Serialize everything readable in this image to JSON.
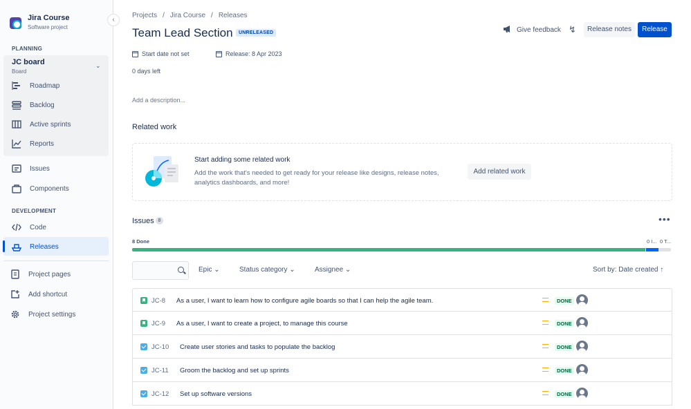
{
  "project": {
    "name": "Jira Course",
    "type": "Software project"
  },
  "sidebar": {
    "planning_label": "PLANNING",
    "board": {
      "name": "JC board",
      "sub": "Board"
    },
    "board_items": [
      "Roadmap",
      "Backlog",
      "Active sprints",
      "Reports"
    ],
    "items": [
      "Issues",
      "Components"
    ],
    "development_label": "DEVELOPMENT",
    "dev_items": [
      "Code",
      "Releases"
    ],
    "bottom_items": [
      "Project pages",
      "Add shortcut",
      "Project settings"
    ]
  },
  "breadcrumbs": [
    "Projects",
    "/",
    "Jira Course",
    "/",
    "Releases"
  ],
  "release": {
    "title": "Team Lead Section",
    "status": "UNRELEASED",
    "start_date": "Start date not set",
    "release_date": "Release: 8 Apr 2023",
    "days_left": "0 days left",
    "description_placeholder": "Add a description..."
  },
  "header_actions": {
    "feedback": "Give feedback",
    "release_notes": "Release notes",
    "release": "Release"
  },
  "related_work": {
    "title": "Related work",
    "heading": "Start adding some related work",
    "text": "Add the work that's needed to get ready for your release like designs, release notes, analytics dashboards, and more!",
    "button": "Add related work"
  },
  "issues": {
    "title": "Issues",
    "count": "8",
    "progress": {
      "done_label": "8 Done",
      "in_progress_label": "0 I...",
      "todo_label": "0 T...",
      "done_fraction": 0.953,
      "in_progress_fraction": 0.022,
      "todo_fraction": 0.025
    },
    "filters": {
      "epic": "Epic",
      "status_category": "Status category",
      "assignee": "Assignee",
      "sort": "Sort by: Date created"
    },
    "rows": [
      {
        "type": "story",
        "key": "JC-8",
        "summary": "As a user, I want to learn how to configure agile boards so that I can help the agile team.",
        "status": "DONE"
      },
      {
        "type": "story",
        "key": "JC-9",
        "summary": "As a user, I want to create a project, to manage this course",
        "status": "DONE"
      },
      {
        "type": "task",
        "key": "JC-10",
        "summary": "Create user stories and tasks to populate the backlog",
        "status": "DONE"
      },
      {
        "type": "task",
        "key": "JC-11",
        "summary": "Groom the backlog and set up sprints",
        "status": "DONE"
      },
      {
        "type": "task",
        "key": "JC-12",
        "summary": "Set up software versions",
        "status": "DONE"
      }
    ]
  },
  "colors": {
    "primary": "#0052cc",
    "done": "#36b37e",
    "in_progress": "#0065ff",
    "medium_priority": "#ffab00",
    "story": "#36b37e",
    "task": "#4bade8"
  }
}
